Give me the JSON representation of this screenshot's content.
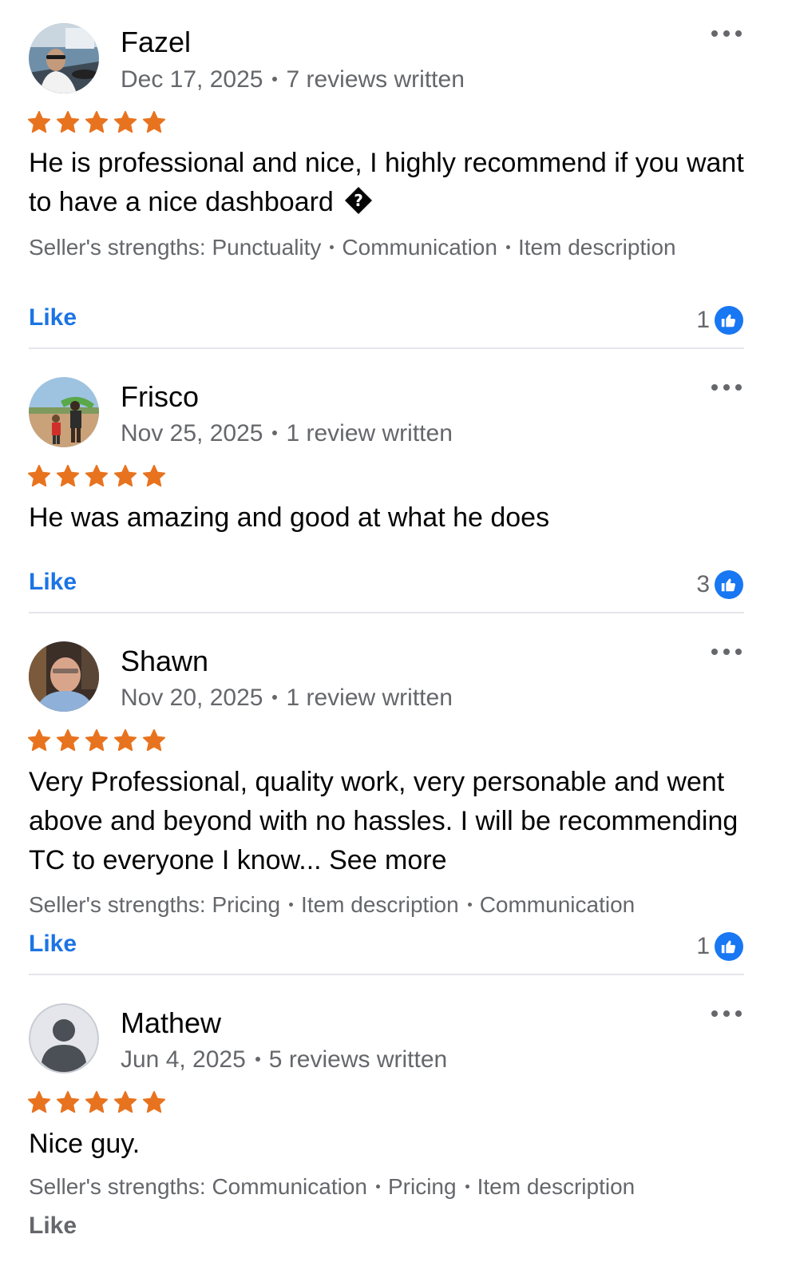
{
  "colors": {
    "star": "#e8731f",
    "link_blue": "#1b74e4",
    "like_badge": "#1877f2",
    "secondary_text": "#65676b",
    "divider": "#e4e6eb"
  },
  "icons": {
    "more": "three-dots-icon",
    "star": "star-icon",
    "like": "thumbs-up-icon",
    "avatar_placeholder": "person-silhouette-icon"
  },
  "reviews": [
    {
      "name": "Fazel",
      "date": "Dec 17, 2025",
      "reviews_written": "7 reviews written",
      "rating": 5,
      "text": "He is professional and nice, I highly recommend if you want to have a nice dashboard",
      "text_suffix_glyph": "�",
      "strengths_label": "Seller's strengths:",
      "strengths": [
        "Punctuality",
        "Communication",
        "Item description"
      ],
      "like_label": "Like",
      "like_count": "1"
    },
    {
      "name": "Frisco",
      "date": "Nov 25, 2025",
      "reviews_written": "1 review written",
      "rating": 5,
      "text": "He was amazing and good at what he does",
      "like_label": "Like",
      "like_count": "3"
    },
    {
      "name": "Shawn",
      "date": "Nov 20, 2025",
      "reviews_written": "1 review written",
      "rating": 5,
      "text": "Very Professional, quality work, very personable and went above and beyond with no hassles. I will be recommending TC to everyone I know...",
      "see_more_label": "See more",
      "strengths_label": "Seller's strengths:",
      "strengths": [
        "Pricing",
        "Item description",
        "Communication"
      ],
      "like_label": "Like",
      "like_count": "1"
    },
    {
      "name": "Mathew",
      "date": "Jun 4, 2025",
      "reviews_written": "5 reviews written",
      "rating": 5,
      "text": "Nice guy.",
      "strengths_label": "Seller's strengths:",
      "strengths": [
        "Communication",
        "Pricing",
        "Item description"
      ],
      "like_label": "Like"
    }
  ]
}
